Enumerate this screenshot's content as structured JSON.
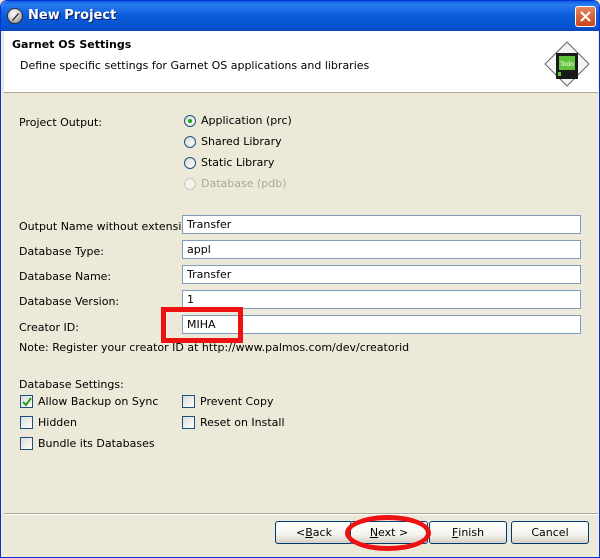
{
  "window": {
    "title": "New Project"
  },
  "header": {
    "title": "Garnet OS Settings",
    "description": "Define specific settings for Garnet OS applications and libraries",
    "logo_text": "Todo"
  },
  "project_output": {
    "label": "Project Output:",
    "options": [
      {
        "label": "Application (prc)",
        "checked": true,
        "disabled": false
      },
      {
        "label": "Shared Library",
        "checked": false,
        "disabled": false
      },
      {
        "label": "Static Library",
        "checked": false,
        "disabled": false
      },
      {
        "label": "Database (pdb)",
        "checked": false,
        "disabled": true
      }
    ]
  },
  "fields": {
    "output_name": {
      "label": "Output Name without extension:",
      "value": "Transfer"
    },
    "database_type": {
      "label": "Database Type:",
      "value": "appl"
    },
    "database_name": {
      "label": "Database Name:",
      "value": "Transfer"
    },
    "database_version": {
      "label": "Database Version:",
      "value": "1"
    },
    "creator_id": {
      "label": "Creator ID:",
      "value": "MIHA"
    }
  },
  "note": "Note: Register your creator ID at http://www.palmos.com/dev/creatorid",
  "database_settings": {
    "label": "Database Settings:",
    "allow_backup": {
      "label": "Allow Backup on Sync",
      "checked": true
    },
    "prevent_copy": {
      "label": "Prevent Copy",
      "checked": false
    },
    "hidden": {
      "label": "Hidden",
      "checked": false
    },
    "reset_on_install": {
      "label": "Reset on Install",
      "checked": false
    },
    "bundle": {
      "label": "Bundle its Databases",
      "checked": false
    }
  },
  "buttons": {
    "back_prefix": "< ",
    "back_key": "B",
    "back_rest": "ack",
    "next_key": "N",
    "next_rest": "ext >",
    "finish_key": "F",
    "finish_rest": "inish",
    "cancel": "Cancel"
  },
  "colors": {
    "annotation": "#ee1111",
    "titlebar": "#0a5bd8"
  }
}
